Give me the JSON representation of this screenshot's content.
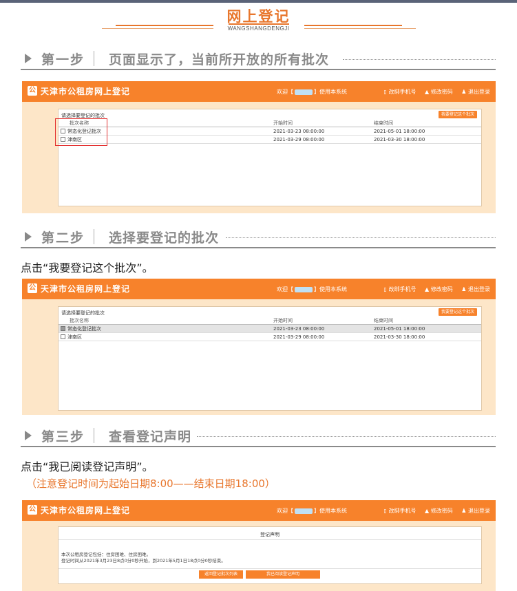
{
  "header": {
    "title": "网上登记",
    "subtitle": "WANGSHANGDENGJI"
  },
  "steps": [
    {
      "num": "第一步",
      "desc": "页面显示了，当前所开放的所有批次"
    },
    {
      "num": "第二步",
      "desc": "选择要登记的批次"
    },
    {
      "num": "第三步",
      "desc": "查看登记声明"
    }
  ],
  "instructions": {
    "step2": "点击“我要登记这个批次”。",
    "step3": "点击“我已阅读登记声明”。",
    "step3_note": "（注意登记时间为起始日期8:00——结束日期18:00）"
  },
  "app": {
    "logo_glyph": "公",
    "name": "天津市公租房网上登记",
    "welcome_prefix": "欢迎【",
    "welcome_suffix": "】使用本系统",
    "links": [
      "▯ 改绑手机号",
      "▲ 修改密码",
      "♟ 退出登录"
    ]
  },
  "batch_panel": {
    "title": "请选择要登记的批次",
    "register_button": "我要登记这个批次",
    "columns": [
      "批次名称",
      "开始时间",
      "结束时间"
    ],
    "rows": [
      {
        "name": "常态化登记批次",
        "start": "2021-03-23 08:00:00",
        "end": "2021-05-01 18:00:00"
      },
      {
        "name": "津南区",
        "start": "2021-03-29 08:00:00",
        "end": "2021-03-30 18:00:00"
      }
    ],
    "selected_in_step2": 0
  },
  "declaration": {
    "title": "登记声明",
    "line1": "本次公租房登记包括：住房困难、住房困难。",
    "line2": "登记时间从2021年3月23日8点0分0秒开始，到2021年5月1日18点0分0秒结束。",
    "back_button": "返回登记批次列表",
    "read_button": "我已阅读登记声明"
  }
}
